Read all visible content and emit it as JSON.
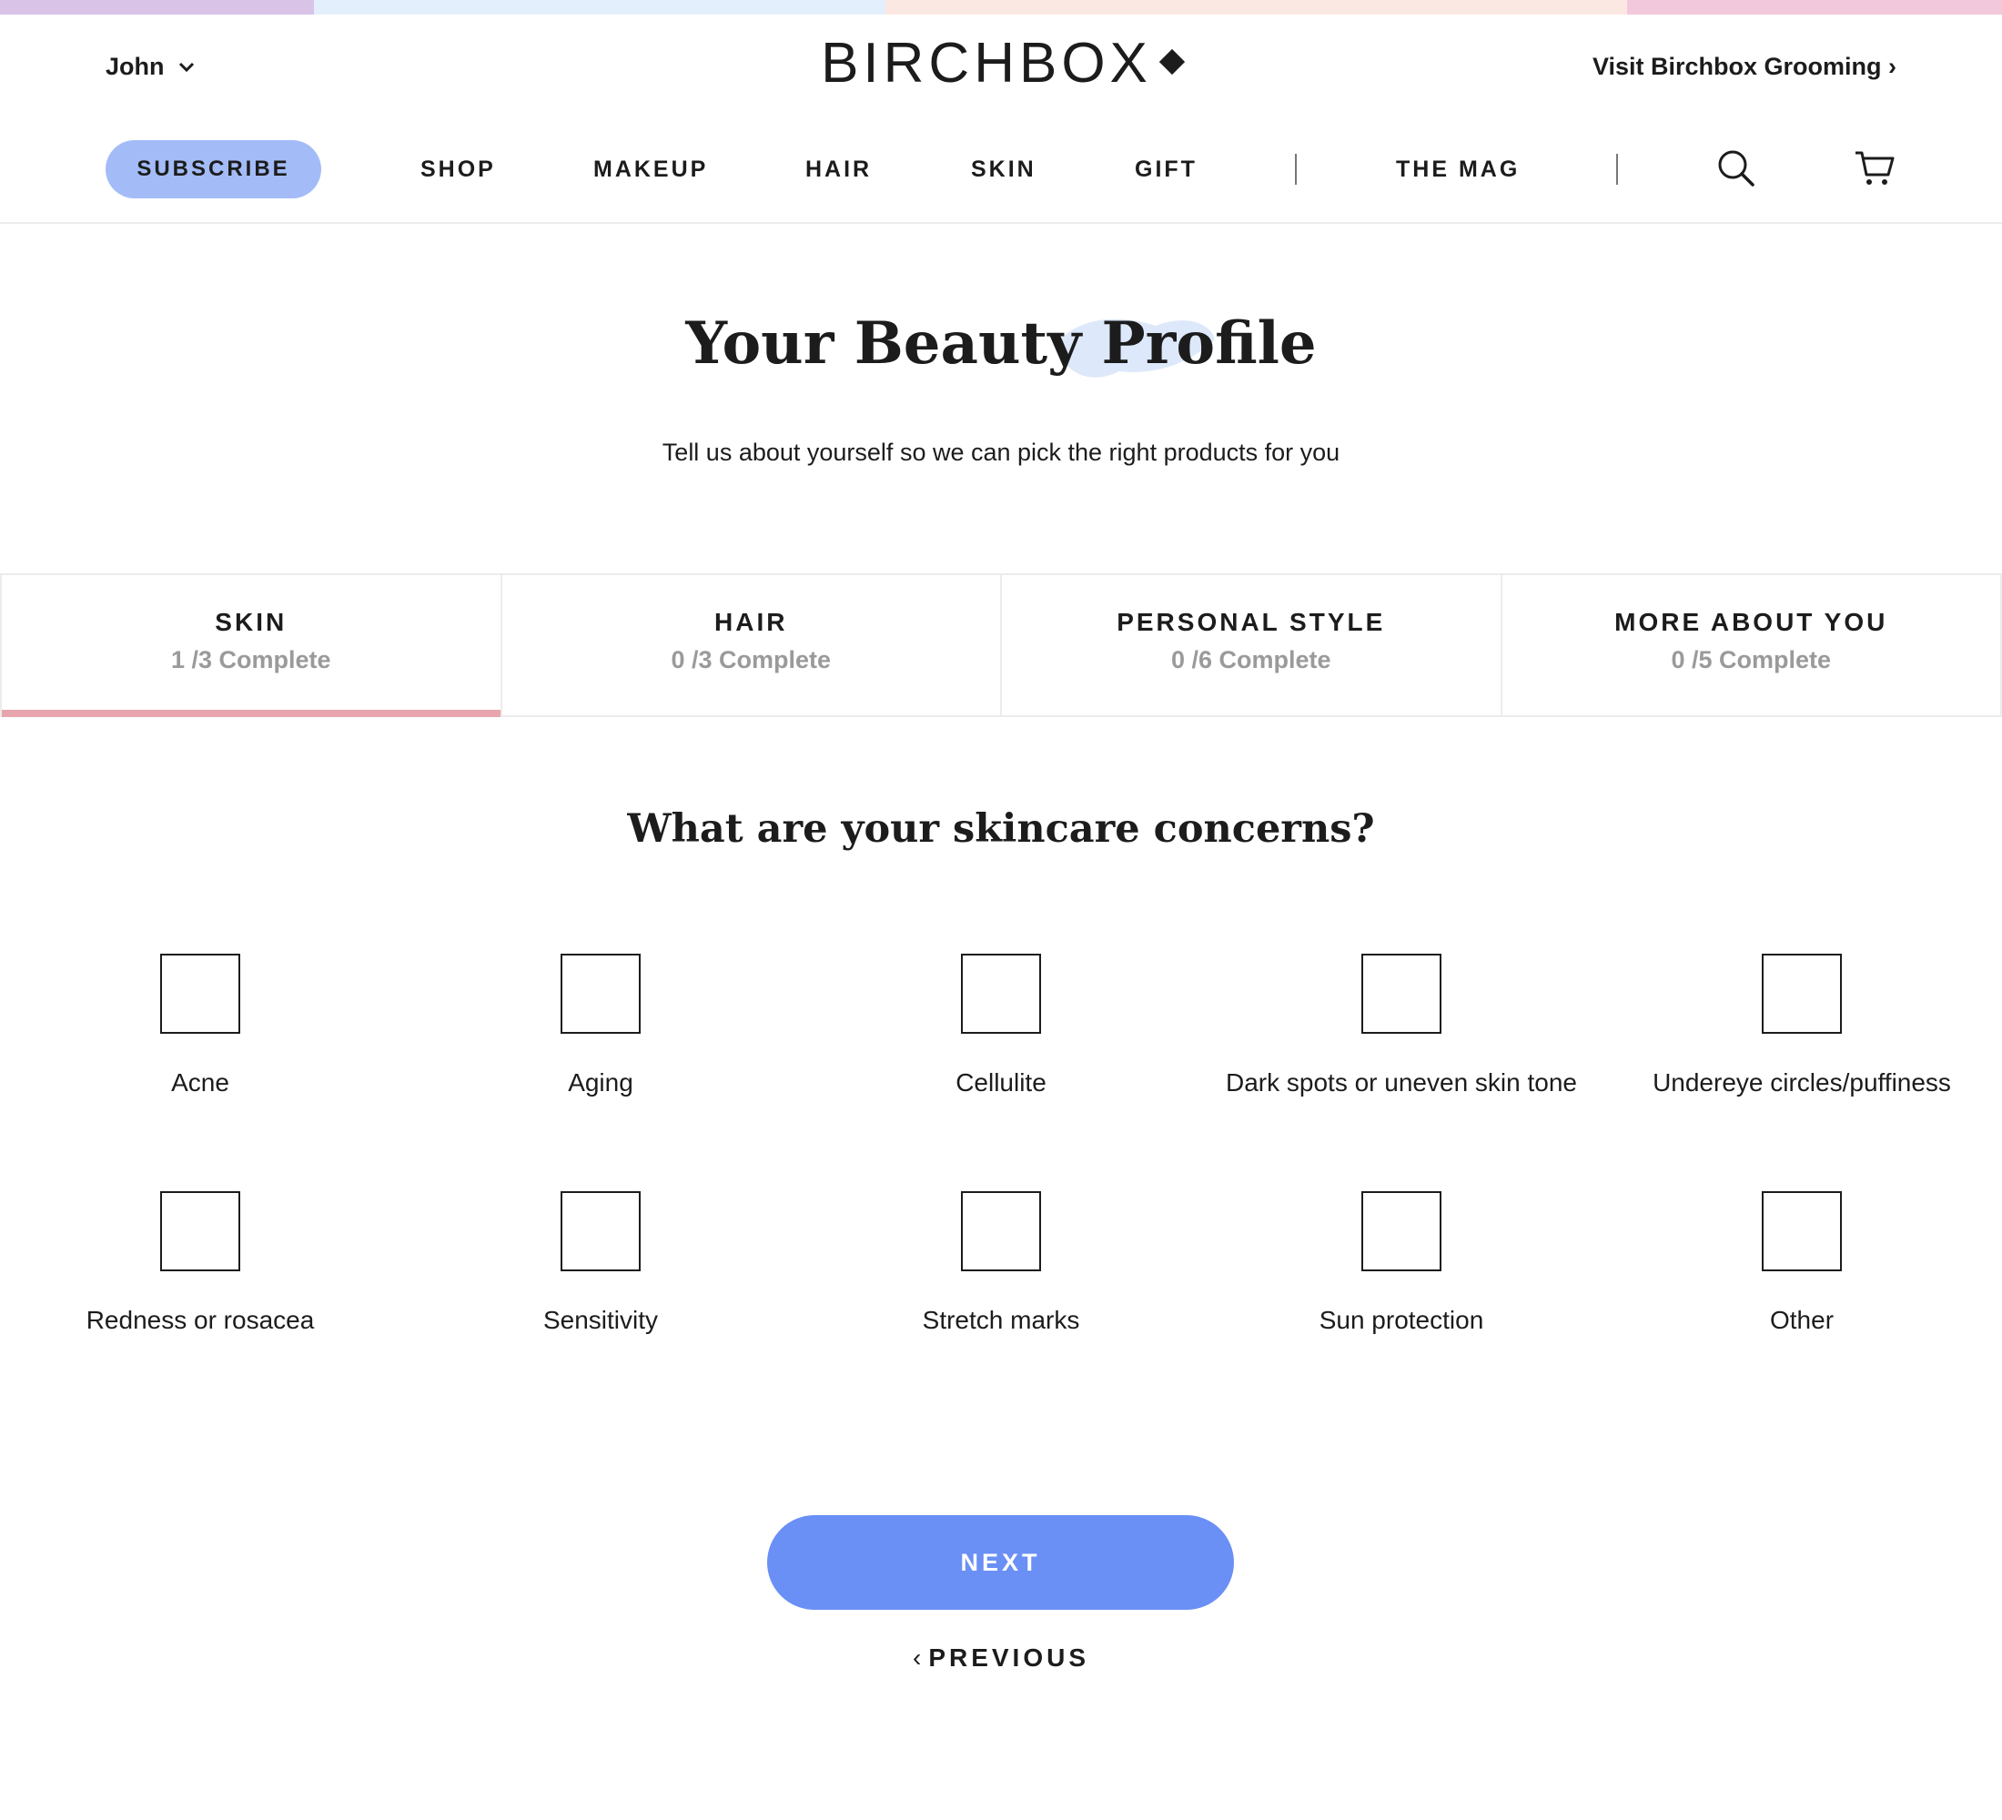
{
  "colors": {
    "top_bar": [
      "#d9c4e8",
      "#e3effc",
      "#fbe8e2",
      "#f2c9dc"
    ],
    "subscribe_bg": "#a3bcf8",
    "next_bg": "#6a8ff5",
    "active_tab_underline": "#e8a5ad",
    "progress_text": "#9a9a9a"
  },
  "header": {
    "user_name": "John",
    "logo": "BIRCHBOX",
    "grooming_link": "Visit Birchbox Grooming ›"
  },
  "nav": {
    "subscribe": "SUBSCRIBE",
    "items": [
      "SHOP",
      "MAKEUP",
      "HAIR",
      "SKIN",
      "GIFT"
    ],
    "mag": "THE MAG",
    "icons": [
      "search-icon",
      "cart-icon"
    ]
  },
  "hero": {
    "title": "Your Beauty Profile",
    "subtitle": "Tell us about yourself so we can pick the right products for you"
  },
  "tabs": [
    {
      "label": "SKIN",
      "progress": "1 /3 Complete",
      "active": true
    },
    {
      "label": "HAIR",
      "progress": "0 /3 Complete",
      "active": false
    },
    {
      "label": "PERSONAL STYLE",
      "progress": "0 /6 Complete",
      "active": false
    },
    {
      "label": "MORE ABOUT YOU",
      "progress": "0 /5 Complete",
      "active": false
    }
  ],
  "question": "What are your skincare concerns?",
  "options": [
    {
      "label": "Acne",
      "checked": false
    },
    {
      "label": "Aging",
      "checked": false
    },
    {
      "label": "Cellulite",
      "checked": false
    },
    {
      "label": "Dark spots or uneven skin tone",
      "checked": false
    },
    {
      "label": "Undereye circles/puffiness",
      "checked": false
    },
    {
      "label": "Redness or rosacea",
      "checked": false
    },
    {
      "label": "Sensitivity",
      "checked": false
    },
    {
      "label": "Stretch marks",
      "checked": false
    },
    {
      "label": "Sun protection",
      "checked": false
    },
    {
      "label": "Other",
      "checked": false
    }
  ],
  "actions": {
    "next": "NEXT",
    "previous": "PREVIOUS"
  }
}
